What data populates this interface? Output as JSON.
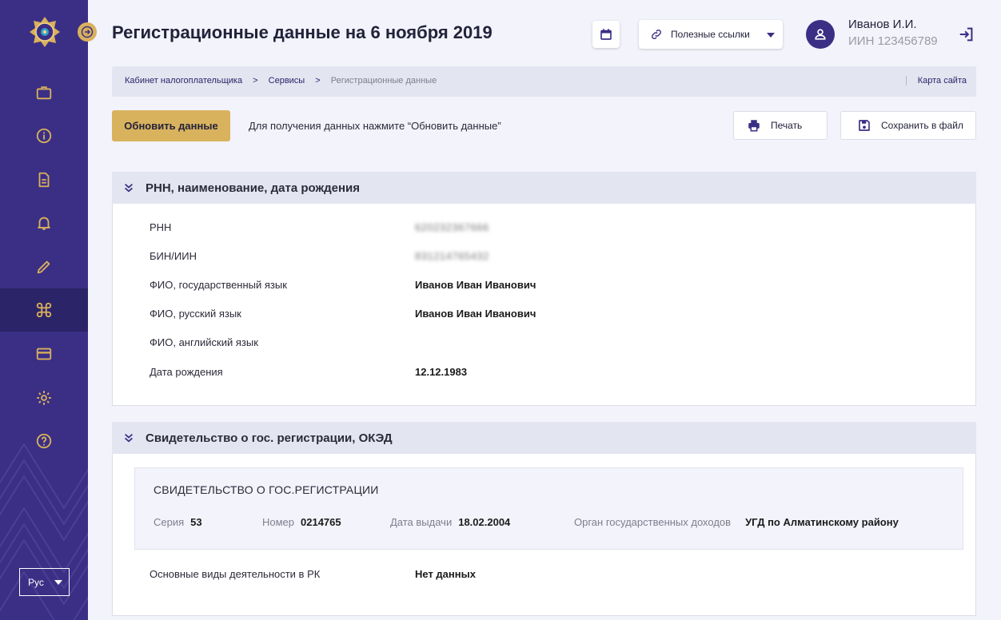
{
  "sidebar": {
    "language": "Рус",
    "items": [
      {
        "name": "briefcase-icon"
      },
      {
        "name": "info-icon"
      },
      {
        "name": "document-icon"
      },
      {
        "name": "bell-icon"
      },
      {
        "name": "pencil-icon"
      },
      {
        "name": "command-icon",
        "active": true
      },
      {
        "name": "card-icon"
      },
      {
        "name": "gear-icon"
      },
      {
        "name": "help-icon"
      }
    ]
  },
  "header": {
    "title": "Регистрационные данные на 6 ноября 2019",
    "links_label": "Полезные ссылки",
    "user_name": "Иванов И.И.",
    "user_iin": "ИИН 123456789"
  },
  "breadcrumb": {
    "items": [
      "Кабинет налогоплательщика",
      "Сервисы"
    ],
    "separator": ">",
    "current": "Регистрационные данные",
    "sitemap": "Карта сайта"
  },
  "toolbar": {
    "refresh_label": "Обновить данные",
    "hint": "Для получения данных нажмите “Обновить данные”",
    "print_label": "Печать",
    "save_label": "Сохранить в файл"
  },
  "section1": {
    "title": "РНН, наименование, дата рождения",
    "fields": [
      {
        "label": "РНН",
        "value": "620232367666"
      },
      {
        "label": "БИН/ИИН",
        "value": "831214765432"
      },
      {
        "label": "ФИО, государственный язык",
        "value": "Иванов Иван Иванович"
      },
      {
        "label": "ФИО, русский язык",
        "value": "Иванов Иван Иванович"
      },
      {
        "label": "ФИО, английский язык",
        "value": ""
      },
      {
        "label": "Дата рождения",
        "value": "12.12.1983"
      }
    ]
  },
  "section2": {
    "title": "Свидетельство о гос. регистрации, ОКЭД",
    "certificate": {
      "title": "СВИДЕТЕЛЬСТВО О ГОС.РЕГИСТРАЦИИ",
      "series_label": "Серия",
      "series": "53",
      "number_label": "Номер",
      "number": "0214765",
      "date_label": "Дата выдачи",
      "date": "18.02.2004",
      "authority_label": "Орган государственных доходов",
      "authority": "УГД по Алматинскому району"
    },
    "activity_label": "Основные виды деятельности в РК",
    "activity_value": "Нет данных"
  },
  "colors": {
    "sidebar": "#3a2f85",
    "accent_gold": "#d9b25e",
    "background": "#f2f3fb",
    "section_header": "#e3e5f1"
  }
}
